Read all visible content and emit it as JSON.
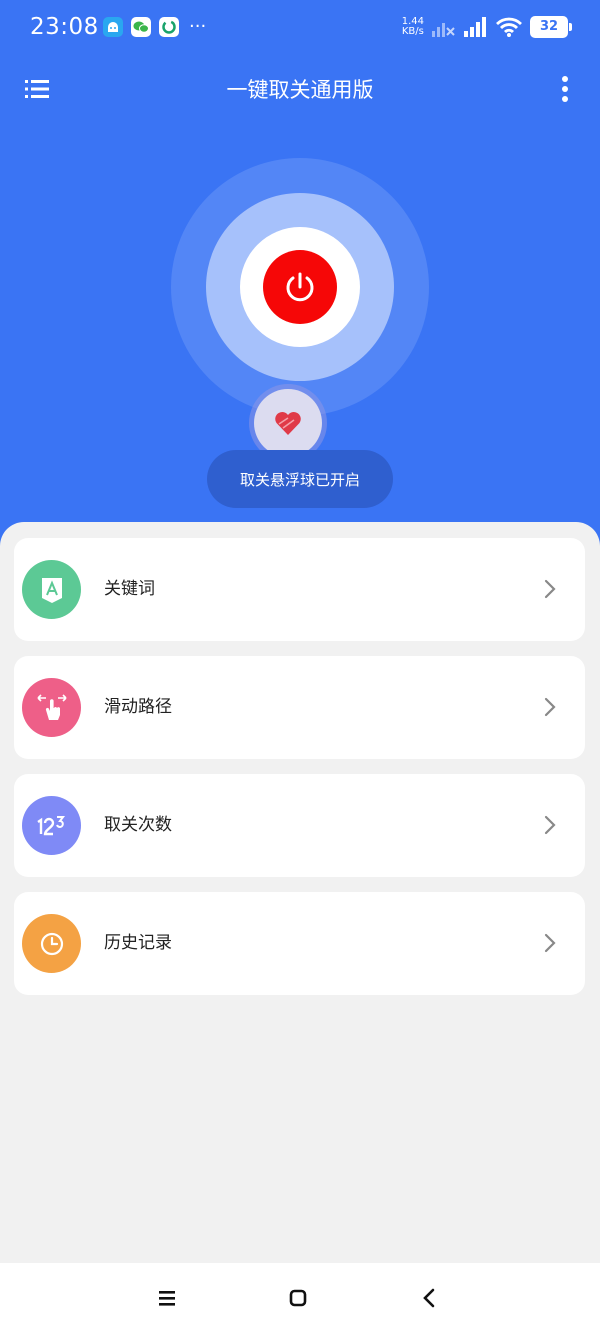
{
  "status_bar": {
    "time": "23:08",
    "net_speed_value": "1.44",
    "net_speed_unit": "KB/s",
    "battery": "32"
  },
  "header": {
    "title": "一键取关通用版"
  },
  "hero": {
    "toast": "取关悬浮球已开启"
  },
  "menu": [
    {
      "label": "关键词",
      "icon": "keyword-icon",
      "color": "#5cc995"
    },
    {
      "label": "滑动路径",
      "icon": "swipe-hand-icon",
      "color": "#ee5f88"
    },
    {
      "label": "取关次数",
      "icon": "number-123-icon",
      "color": "#7f8af6"
    },
    {
      "label": "历史记录",
      "icon": "clock-icon",
      "color": "#f4a244"
    }
  ],
  "colors": {
    "primary": "#3a74f4",
    "power": "#f60707",
    "toast_bg": "#2f5fcf"
  }
}
